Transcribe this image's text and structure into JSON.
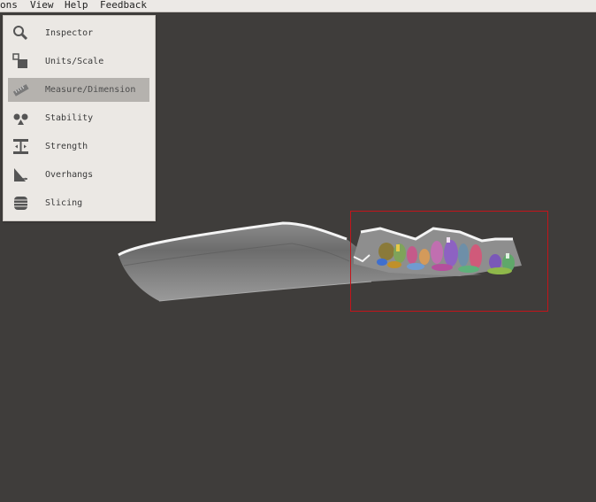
{
  "menubar": {
    "items": [
      "ons",
      "View",
      "Help",
      "Feedback"
    ]
  },
  "toolpanel": {
    "items": [
      {
        "label": "Inspector",
        "icon": "magnifier-icon"
      },
      {
        "label": "Units/Scale",
        "icon": "units-scale-icon"
      },
      {
        "label": "Measure/Dimension",
        "icon": "ruler-icon",
        "active": true
      },
      {
        "label": "Stability",
        "icon": "stability-icon"
      },
      {
        "label": "Strength",
        "icon": "strength-icon"
      },
      {
        "label": "Overhangs",
        "icon": "overhang-icon"
      },
      {
        "label": "Slicing",
        "icon": "slicing-icon"
      }
    ]
  },
  "colors": {
    "viewport_bg": "#3f3d3b",
    "panel_bg": "#ebe8e4",
    "active_item_bg": "#b5b2ae",
    "selection_border": "#c3141a"
  }
}
